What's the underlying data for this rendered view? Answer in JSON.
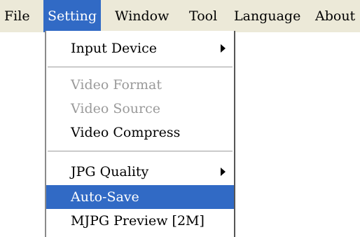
{
  "menubar": {
    "items": [
      {
        "label": "File"
      },
      {
        "label": "Setting"
      },
      {
        "label": "Window"
      },
      {
        "label": "Tool"
      },
      {
        "label": "Language"
      },
      {
        "label": "About"
      }
    ]
  },
  "dropdown": {
    "items": [
      {
        "label": "Input Device",
        "state": "enabled",
        "submenu": true
      },
      {
        "label": "Video Format",
        "state": "disabled",
        "submenu": false
      },
      {
        "label": "Video Source",
        "state": "disabled",
        "submenu": false
      },
      {
        "label": "Video Compress",
        "state": "enabled",
        "submenu": false
      },
      {
        "label": "JPG Quality",
        "state": "enabled",
        "submenu": true
      },
      {
        "label": "Auto-Save",
        "state": "highlighted",
        "submenu": false
      },
      {
        "label": "MJPG Preview [2M]",
        "state": "enabled",
        "submenu": false
      }
    ]
  },
  "colors": {
    "menubar_bg": "#ece9d8",
    "highlight": "#316ac5",
    "disabled_text": "#9a9a9a"
  }
}
